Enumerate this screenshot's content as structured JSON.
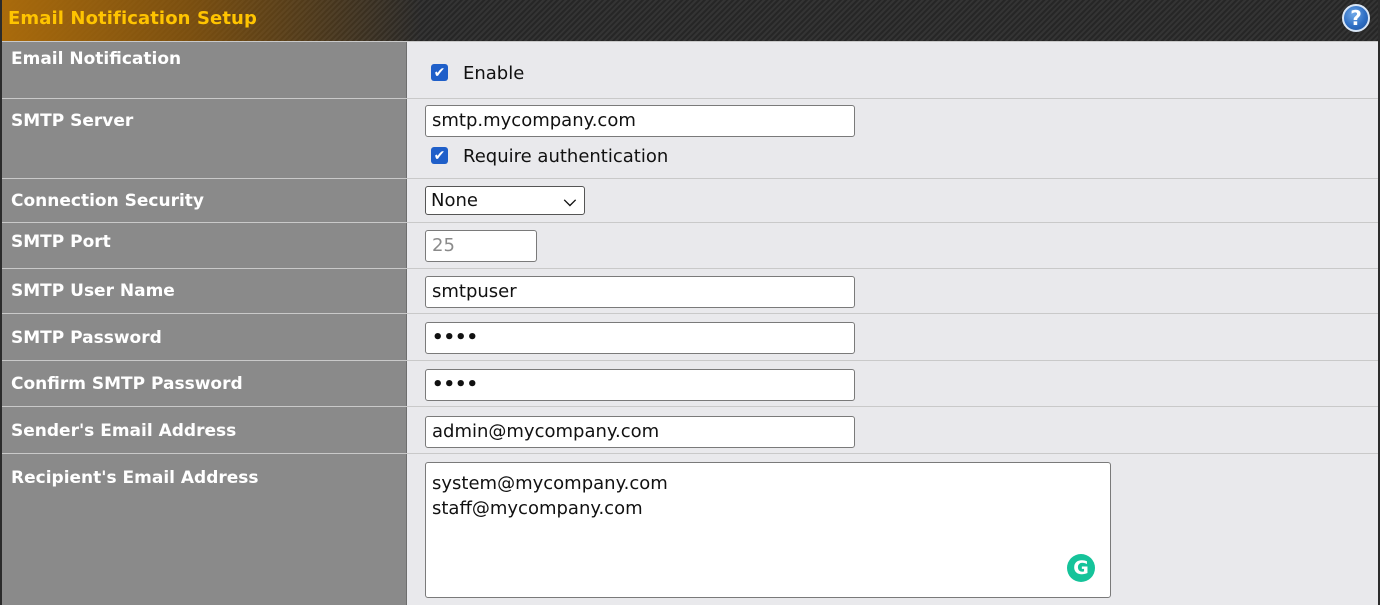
{
  "header": {
    "title": "Email Notification Setup",
    "help_glyph": "?",
    "help_icon": "question-mark-icon"
  },
  "rows": {
    "email_notification": {
      "label": "Email Notification",
      "checkbox_label": "Enable",
      "checked": true
    },
    "smtp_server": {
      "label": "SMTP Server",
      "value": "smtp.mycompany.com",
      "auth_label": "Require authentication",
      "auth_checked": true
    },
    "connection_security": {
      "label": "Connection Security",
      "selected": "None",
      "chevron": "∨"
    },
    "smtp_port": {
      "label": "SMTP Port",
      "value": "25"
    },
    "smtp_user": {
      "label": "SMTP User Name",
      "value": "smtpuser"
    },
    "smtp_password": {
      "label": "SMTP Password",
      "value": "••••"
    },
    "confirm_password": {
      "label": "Confirm SMTP Password",
      "value": "••••"
    },
    "sender_email": {
      "label": "Sender's Email Address",
      "value": "admin@mycompany.com"
    },
    "recipient_email": {
      "label": "Recipient's Email Address",
      "lines": [
        "system@mycompany.com",
        "staff@mycompany.com"
      ]
    }
  },
  "icons": {
    "checkmark": "✔",
    "grammarly": "G"
  },
  "colors": {
    "title": "#ffc400",
    "label_bg": "#8a8a8a",
    "value_bg": "#e9e9ec",
    "checkbox": "#1f5fc9",
    "grammarly": "#15c39a"
  }
}
